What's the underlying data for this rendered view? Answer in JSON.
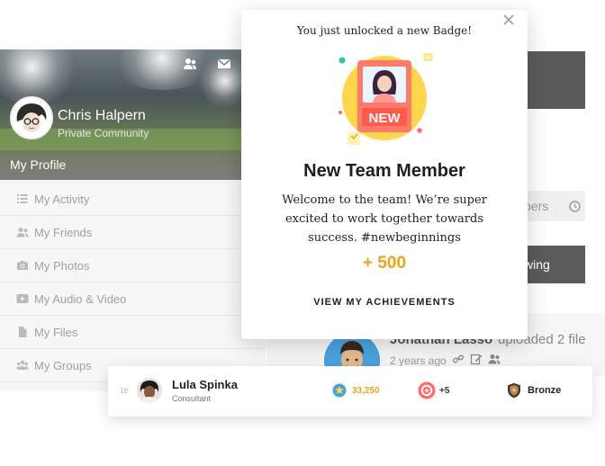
{
  "profile": {
    "name": "Chris Halpern",
    "subtitle": "Private Community",
    "section_label": "My Profile",
    "header_icons": [
      "friends-icon",
      "envelope-icon"
    ]
  },
  "menu": {
    "items": [
      {
        "label": "My Activity",
        "icon": "list-icon"
      },
      {
        "label": "My Friends",
        "icon": "users-icon"
      },
      {
        "label": "My Photos",
        "icon": "camera-icon"
      },
      {
        "label": "My Audio & Video",
        "icon": "play-icon"
      },
      {
        "label": "My Files",
        "icon": "file-icon"
      },
      {
        "label": "My Groups",
        "icon": "groups-icon"
      }
    ]
  },
  "feed": {
    "members_tab": "bers",
    "following_button": "wing",
    "author": "Jonathan Lasso",
    "action": "uploaded 2 file",
    "time": "2 years ago"
  },
  "popup": {
    "subtitle": "You just unlocked a new Badge!",
    "badge_art_text": "NEW",
    "title": "New Team Member",
    "description": "Welcome to the team! We’re super excited to work together towards success. #newbeginnings",
    "points": "+ 500",
    "link": "VIEW MY ACHIEVEMENTS"
  },
  "leaderboard": {
    "rank_number": "18",
    "name": "Lula Spinka",
    "role": "Consultant",
    "points": "33,250",
    "badges": "+5",
    "rank": "Bronze"
  },
  "colors": {
    "accent_gold": "#f0a318",
    "badge_pink": "#ff6b6b",
    "badge_yellow": "#ffd54a",
    "dark_button": "#5b5b5b"
  }
}
